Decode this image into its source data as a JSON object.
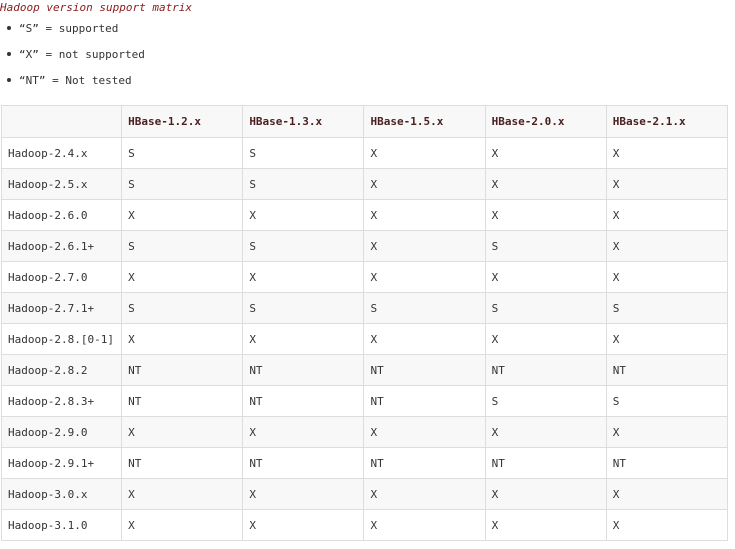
{
  "title": "Hadoop version support matrix",
  "legend": [
    "“S” = supported",
    "“X” = not supported",
    "“NT” = Not tested"
  ],
  "table": {
    "columns": [
      "",
      "HBase-1.2.x",
      "HBase-1.3.x",
      "HBase-1.5.x",
      "HBase-2.0.x",
      "HBase-2.1.x"
    ],
    "rows": [
      [
        "Hadoop-2.4.x",
        "S",
        "S",
        "X",
        "X",
        "X"
      ],
      [
        "Hadoop-2.5.x",
        "S",
        "S",
        "X",
        "X",
        "X"
      ],
      [
        "Hadoop-2.6.0",
        "X",
        "X",
        "X",
        "X",
        "X"
      ],
      [
        "Hadoop-2.6.1+",
        "S",
        "S",
        "X",
        "S",
        "X"
      ],
      [
        "Hadoop-2.7.0",
        "X",
        "X",
        "X",
        "X",
        "X"
      ],
      [
        "Hadoop-2.7.1+",
        "S",
        "S",
        "S",
        "S",
        "S"
      ],
      [
        "Hadoop-2.8.[0-1]",
        "X",
        "X",
        "X",
        "X",
        "X"
      ],
      [
        "Hadoop-2.8.2",
        "NT",
        "NT",
        "NT",
        "NT",
        "NT"
      ],
      [
        "Hadoop-2.8.3+",
        "NT",
        "NT",
        "NT",
        "S",
        "S"
      ],
      [
        "Hadoop-2.9.0",
        "X",
        "X",
        "X",
        "X",
        "X"
      ],
      [
        "Hadoop-2.9.1+",
        "NT",
        "NT",
        "NT",
        "NT",
        "NT"
      ],
      [
        "Hadoop-3.0.x",
        "X",
        "X",
        "X",
        "X",
        "X"
      ],
      [
        "Hadoop-3.1.0",
        "X",
        "X",
        "X",
        "X",
        "X"
      ]
    ]
  }
}
